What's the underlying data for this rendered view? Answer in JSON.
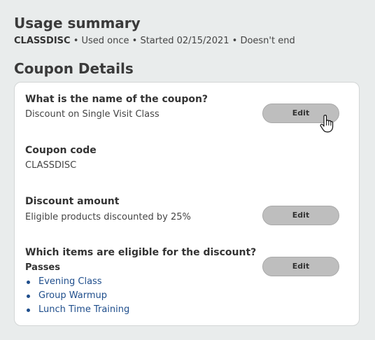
{
  "usage": {
    "title": "Usage summary",
    "code": "CLASSDISC",
    "details": "• Used once • Started 02/15/2021 • Doesn't end"
  },
  "details": {
    "title": "Coupon Details",
    "edit_label": "Edit",
    "fields": {
      "name": {
        "label": "What is the name of the coupon?",
        "value": "Discount on Single Visit Class"
      },
      "code": {
        "label": "Coupon code",
        "value": "CLASSDISC"
      },
      "discount": {
        "label": "Discount amount",
        "value": "Eligible products discounted by 25%"
      },
      "items": {
        "label": "Which items are eligible for the discount?",
        "group_label": "Passes",
        "list": [
          "Evening Class",
          "Group Warmup",
          "Lunch Time Training"
        ]
      }
    }
  },
  "cursor": {
    "icon": "hand-pointer-icon"
  },
  "colors": {
    "background": "#e9ecec",
    "card": "#ffffff",
    "button": "#bebebe",
    "link": "#1f4e8c"
  }
}
